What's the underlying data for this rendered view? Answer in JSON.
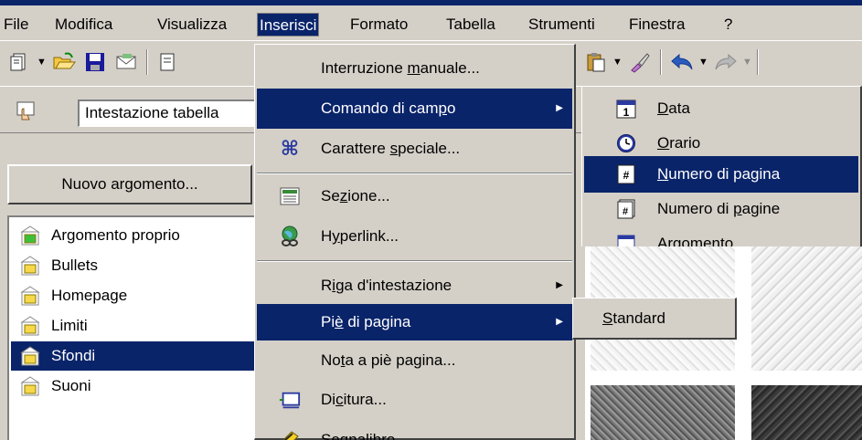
{
  "menubar": {
    "items": [
      "File",
      "Modifica",
      "Visualizza",
      "Inserisci",
      "Formato",
      "Tabella",
      "Strumenti",
      "Finestra",
      "?"
    ]
  },
  "toolbar2": {
    "style_combo_value": "Intestazione tabella"
  },
  "left_pane": {
    "new_topic_button": "Nuovo argomento...",
    "topics": [
      "Argomento proprio",
      "Bullets",
      "Homepage",
      "Limiti",
      "Sfondi",
      "Suoni"
    ],
    "selected_topic": "Sfondi"
  },
  "inserisci_menu": {
    "items": [
      {
        "label": "Interruzione manuale...",
        "icon": ""
      },
      {
        "label": "Comando di campo",
        "icon": "",
        "submenu": true
      },
      {
        "label": "Carattere speciale...",
        "icon": "special-character-icon"
      },
      {
        "label": "Sezione...",
        "icon": "section-icon"
      },
      {
        "label": "Hyperlink...",
        "icon": "hyperlink-globe-icon"
      },
      {
        "label": "Riga d'intestazione",
        "icon": "",
        "submenu": true
      },
      {
        "label": "Piè di pagina",
        "icon": "",
        "submenu": true
      },
      {
        "label": "Nota a piè pagina...",
        "icon": ""
      },
      {
        "label": "Dicitura...",
        "icon": "caption-icon"
      },
      {
        "label": "Segnalibro...",
        "icon": "bookmark-icon"
      }
    ],
    "highlighted": [
      "Comando di campo",
      "Piè di pagina"
    ]
  },
  "comando_di_campo_submenu": {
    "items": [
      {
        "label": "Data",
        "icon": "calendar-icon"
      },
      {
        "label": "Orario",
        "icon": "clock-icon"
      },
      {
        "label": "Numero di pagina",
        "icon": "page-number-icon"
      },
      {
        "label": "Numero di pagine",
        "icon": "page-count-icon"
      },
      {
        "label": "Argomento",
        "icon": "topic-icon"
      }
    ],
    "highlighted": "Numero di pagina"
  },
  "pie_di_pagina_submenu": {
    "items": [
      "Standard"
    ]
  },
  "colors": {
    "face": "#d4d0c8",
    "highlight": "#0a246a",
    "window": "#ffffff"
  }
}
